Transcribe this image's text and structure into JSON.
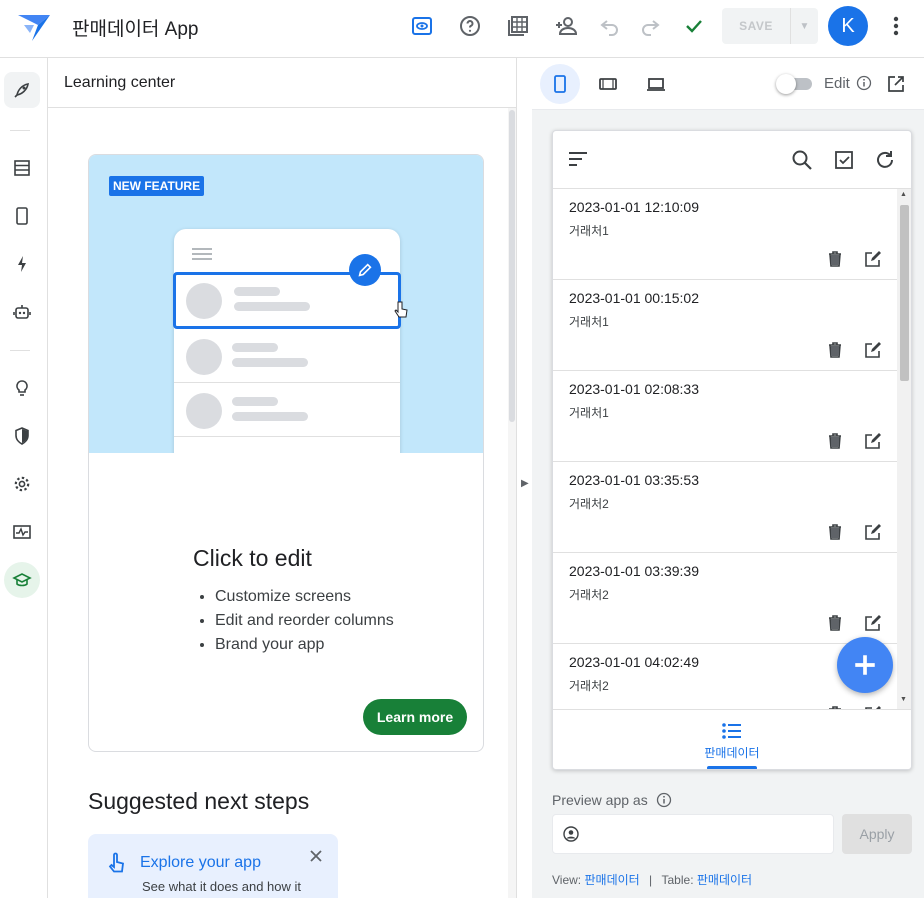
{
  "app": {
    "title": "판매데이터 App"
  },
  "toolbar": {
    "save_label": "SAVE",
    "avatar_letter": "K"
  },
  "learning_center": {
    "header": "Learning center",
    "badge": "NEW FEATURE",
    "card_title": "Click to edit",
    "bullets": [
      "Customize screens",
      "Edit and reorder columns",
      "Brand your app"
    ],
    "learn_more": "Learn more",
    "suggested_title": "Suggested next steps",
    "explore_title": "Explore your app",
    "explore_desc": "See what it does and how it"
  },
  "preview": {
    "edit_label": "Edit",
    "rows": [
      {
        "datetime": "2023-01-01 12:10:09",
        "vendor": "거래처1"
      },
      {
        "datetime": "2023-01-01 00:15:02",
        "vendor": "거래처1"
      },
      {
        "datetime": "2023-01-01 02:08:33",
        "vendor": "거래처1"
      },
      {
        "datetime": "2023-01-01 03:35:53",
        "vendor": "거래처2"
      },
      {
        "datetime": "2023-01-01 03:39:39",
        "vendor": "거래처2"
      },
      {
        "datetime": "2023-01-01 04:02:49",
        "vendor": "거래처2"
      }
    ],
    "nav_label": "판매데이터",
    "preview_as": "Preview app as",
    "apply": "Apply",
    "view_label": "View:",
    "view_value": "판매데이터",
    "table_label": "Table:",
    "table_value": "판매데이터"
  },
  "colors": {
    "accent": "#1a73e8",
    "green": "#188038",
    "hero_bg": "#c2e7fb"
  }
}
